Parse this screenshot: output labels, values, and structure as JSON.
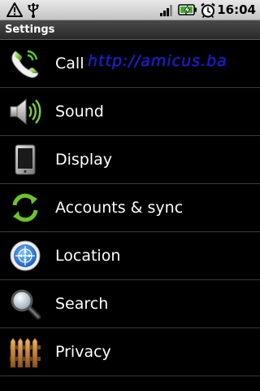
{
  "status_bar": {
    "time": "16:04",
    "icons": [
      "warning-icon",
      "usb-icon",
      "signal-icon",
      "battery-charging-icon",
      "alarm-clock-icon"
    ]
  },
  "header": {
    "title": "Settings"
  },
  "watermark": "http://amicus.ba",
  "settings": {
    "items": [
      {
        "label": "Call",
        "icon": "phone-icon"
      },
      {
        "label": "Sound",
        "icon": "speaker-icon"
      },
      {
        "label": "Display",
        "icon": "display-icon"
      },
      {
        "label": "Accounts & sync",
        "icon": "sync-icon"
      },
      {
        "label": "Location",
        "icon": "location-icon"
      },
      {
        "label": "Search",
        "icon": "search-icon"
      },
      {
        "label": "Privacy",
        "icon": "fence-icon"
      }
    ]
  },
  "colors": {
    "background": "#000000",
    "status_bar": "#d6d6d6",
    "title_bar": "#3a3a3a",
    "divider": "#3a3a3a",
    "watermark": "#1a1acc"
  }
}
